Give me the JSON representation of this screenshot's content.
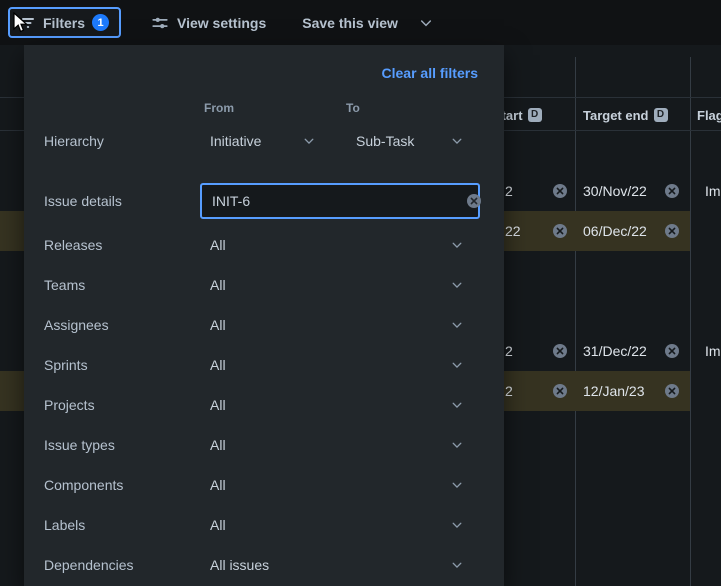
{
  "topbar": {
    "filters": {
      "label": "Filters",
      "count": "1"
    },
    "view_settings": "View settings",
    "save_view": "Save this view"
  },
  "panel": {
    "clear_all": "Clear all filters",
    "from_label": "From",
    "to_label": "To",
    "hierarchy": {
      "label": "Hierarchy",
      "from": "Initiative",
      "to": "Sub-Task"
    },
    "issue_details": {
      "label": "Issue details",
      "value": "INIT-6"
    },
    "filters": [
      {
        "label": "Releases",
        "value": "All"
      },
      {
        "label": "Teams",
        "value": "All"
      },
      {
        "label": "Assignees",
        "value": "All"
      },
      {
        "label": "Sprints",
        "value": "All"
      },
      {
        "label": "Projects",
        "value": "All"
      },
      {
        "label": "Issue types",
        "value": "All"
      },
      {
        "label": "Components",
        "value": "All"
      },
      {
        "label": "Labels",
        "value": "All"
      },
      {
        "label": "Dependencies",
        "value": "All issues"
      }
    ]
  },
  "table": {
    "headers": {
      "target_start": "Target start",
      "target_start_badge": "D",
      "target_end": "Target end",
      "target_end_badge": "D",
      "flags": "Flags"
    },
    "rows": [
      {
        "start": "2",
        "end": "30/Nov/22",
        "flag": "Im"
      },
      {
        "start": "22",
        "end": "06/Dec/22",
        "flag": ""
      },
      {
        "start": "2",
        "end": "31/Dec/22",
        "flag": "Im"
      },
      {
        "start": "2",
        "end": "12/Jan/23",
        "flag": ""
      }
    ]
  },
  "colors": {
    "accent_blue": "#579DFF",
    "badge_blue": "#1D7AFC",
    "highlight_row": "#363321",
    "panel_bg": "#22272B"
  }
}
